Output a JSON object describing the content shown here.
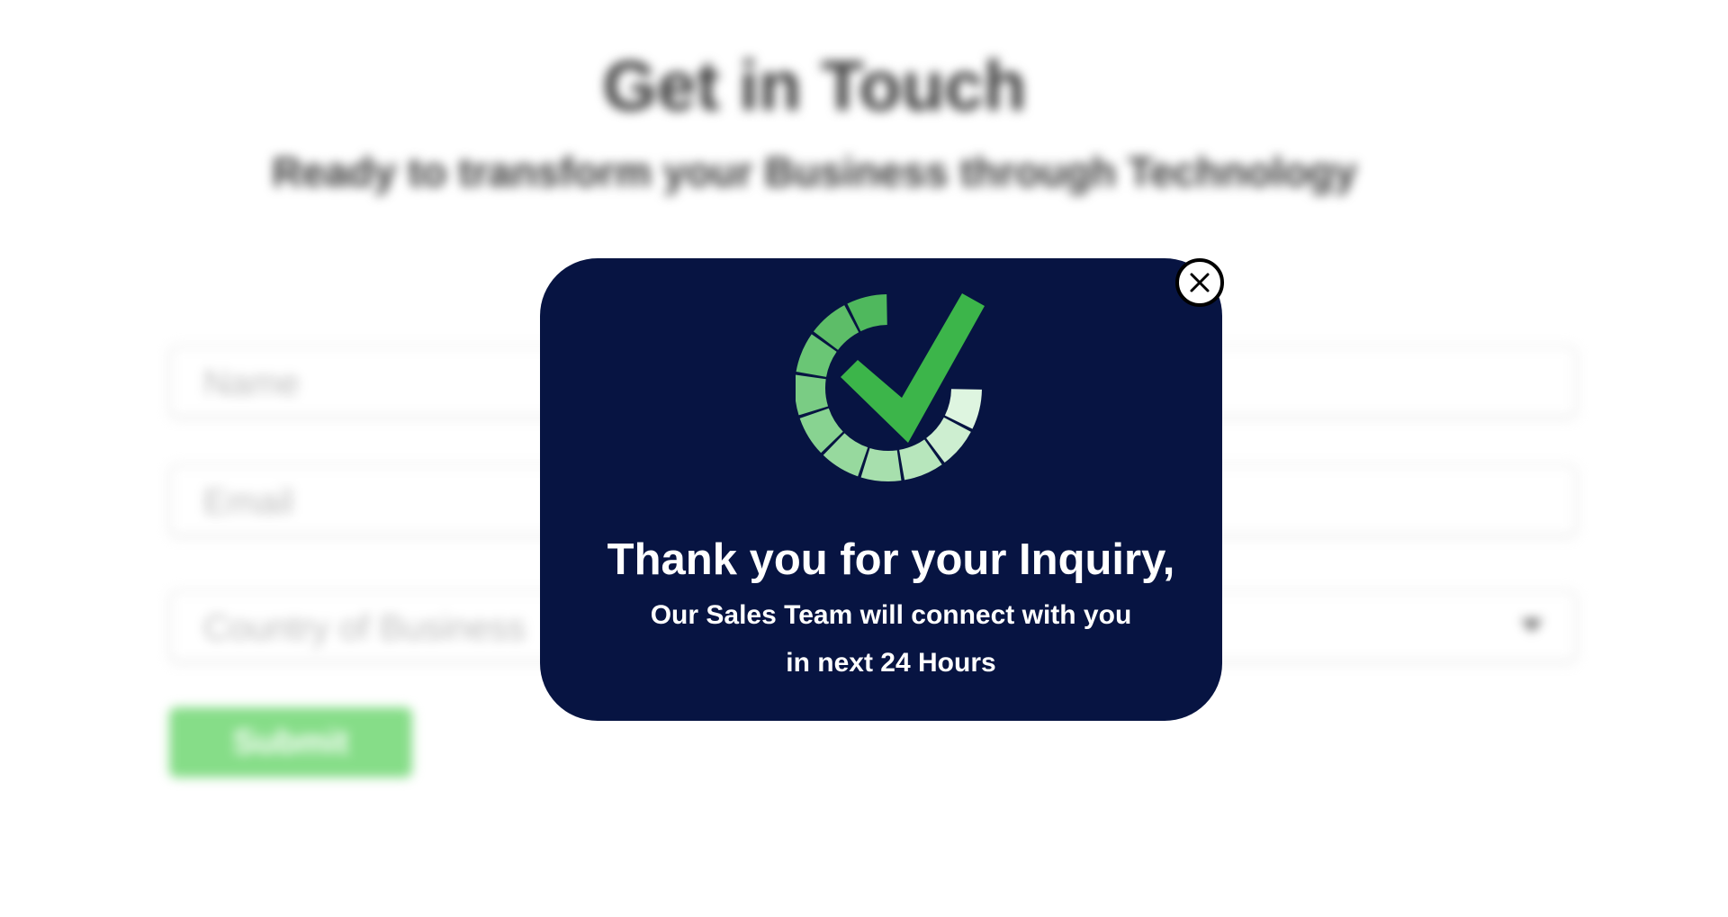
{
  "background_form": {
    "title": "Get in Touch",
    "subtitle": "Ready to transform your Business through Technology",
    "name_placeholder": "Name",
    "email_placeholder": "Email",
    "country_placeholder": "Country of Business",
    "submit_label": "Submit"
  },
  "modal": {
    "icon": "success-check-icon",
    "heading": "Thank you for your Inquiry,",
    "line1": "Our Sales Team will connect with you",
    "line2": "in next 24 Hours",
    "close_icon": "close-icon"
  },
  "colors": {
    "modal_background": "#071442",
    "check_green": "#3cb54a",
    "submit_green": "#86dd88"
  }
}
